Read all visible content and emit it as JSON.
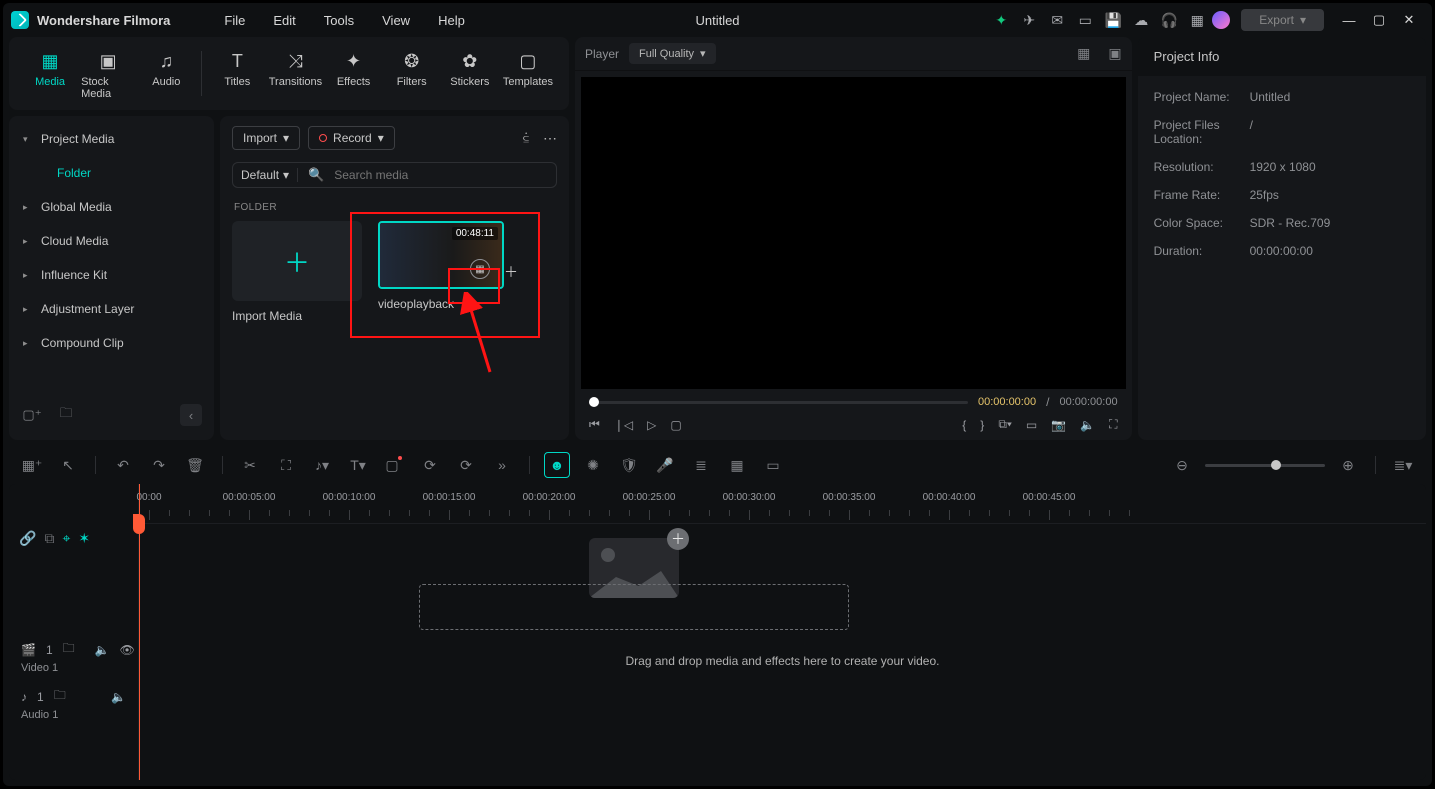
{
  "app": {
    "name": "Wondershare Filmora",
    "document": "Untitled"
  },
  "menu": [
    "File",
    "Edit",
    "Tools",
    "View",
    "Help"
  ],
  "export_label": "Export",
  "tabs": [
    {
      "label": "Media",
      "active": true,
      "ico": "▦"
    },
    {
      "label": "Stock Media",
      "ico": "▣"
    },
    {
      "label": "Audio",
      "ico": "♫"
    },
    {
      "label": "Titles",
      "ico": "T"
    },
    {
      "label": "Transitions",
      "ico": "⤨"
    },
    {
      "label": "Effects",
      "ico": "✦"
    },
    {
      "label": "Filters",
      "ico": "❂"
    },
    {
      "label": "Stickers",
      "ico": "✿"
    },
    {
      "label": "Templates",
      "ico": "▢"
    }
  ],
  "sidebar": {
    "items": [
      {
        "label": "Project Media",
        "open": true
      },
      {
        "label": "Global Media"
      },
      {
        "label": "Cloud Media"
      },
      {
        "label": "Influence Kit"
      },
      {
        "label": "Adjustment Layer"
      },
      {
        "label": "Compound Clip"
      }
    ],
    "folder_label": "Folder"
  },
  "media": {
    "import_label": "Import",
    "record_label": "Record",
    "default_label": "Default",
    "search_placeholder": "Search media",
    "folder_header": "FOLDER",
    "import_media_label": "Import Media",
    "clip_name": "videoplayback",
    "clip_duration": "00:48:11"
  },
  "player": {
    "label": "Player",
    "quality": "Full Quality",
    "current": "00:00:00:00",
    "total": "00:00:00:00"
  },
  "info": {
    "title": "Project Info",
    "rows": [
      {
        "k": "Project Name:",
        "v": "Untitled"
      },
      {
        "k": "Project Files Location:",
        "v": "/"
      },
      {
        "k": "Resolution:",
        "v": "1920 x 1080"
      },
      {
        "k": "Frame Rate:",
        "v": "25fps"
      },
      {
        "k": "Color Space:",
        "v": "SDR - Rec.709"
      },
      {
        "k": "Duration:",
        "v": "00:00:00:00"
      }
    ]
  },
  "timeline": {
    "ruler": [
      "00:00",
      "00:00:05:00",
      "00:00:10:00",
      "00:00:15:00",
      "00:00:20:00",
      "00:00:25:00",
      "00:00:30:00",
      "00:00:35:00",
      "00:00:40:00",
      "00:00:45:00"
    ],
    "video_track": "Video 1",
    "audio_track": "Audio 1",
    "drop_text": "Drag and drop media and effects here to create your video."
  }
}
